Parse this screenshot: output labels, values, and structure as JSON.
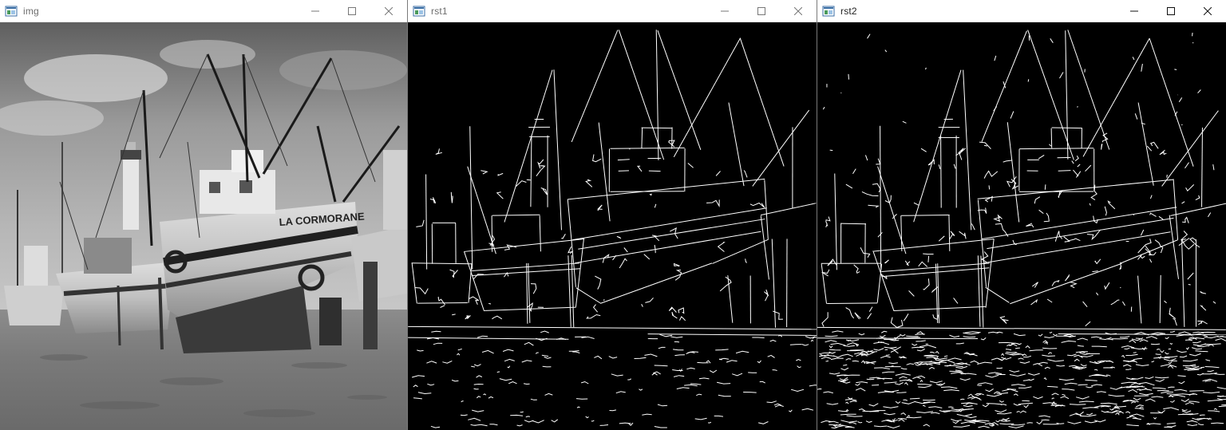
{
  "windows": [
    {
      "title": "img",
      "icon": "opencv-window-icon",
      "controls": [
        "minimize-icon",
        "maximize-icon",
        "close-icon"
      ],
      "content": "grayscale photograph of fishing boats on a beach"
    },
    {
      "title": "rst1",
      "icon": "opencv-window-icon",
      "controls": [
        "minimize-icon",
        "maximize-icon",
        "close-icon"
      ],
      "content": "edge detection result"
    },
    {
      "title": "rst2",
      "icon": "opencv-window-icon",
      "controls": [
        "minimize-icon",
        "maximize-icon",
        "close-icon"
      ],
      "content": "edge detection result"
    }
  ],
  "colors": {
    "titlebar_bg": "#ffffff",
    "inactive_title": "#6d6d6d",
    "active_title": "#1f1f1f",
    "edge_bg": "#000000",
    "edge_fg": "#ffffff"
  }
}
